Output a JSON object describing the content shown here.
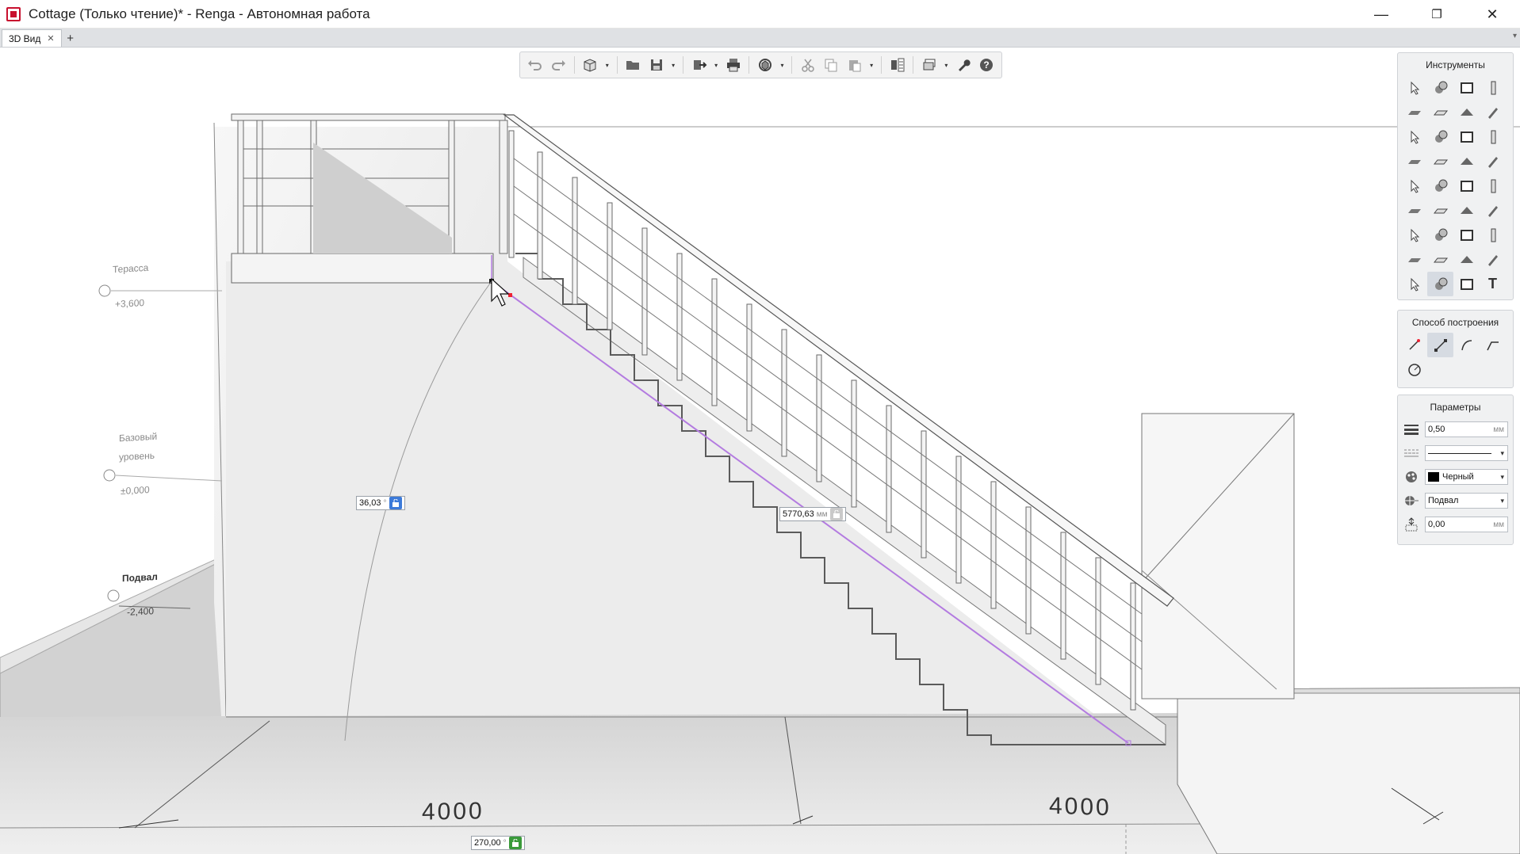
{
  "window": {
    "title": "Cottage (Только чтение)* - Renga - Автономная работа",
    "minimize": "—",
    "maximize": "❐",
    "close": "✕"
  },
  "tabs": [
    {
      "label": "3D Вид",
      "close": "✕"
    }
  ],
  "tab_add": "+",
  "tab_menu": "▾",
  "toolbar": {
    "icons": [
      "undo-icon",
      "redo-icon",
      "view-cube-icon",
      "open-folder-icon",
      "save-icon",
      "export-icon",
      "print-icon",
      "orbit-icon",
      "cut-icon",
      "copy-icon",
      "paste-icon",
      "compare-icon",
      "layers-icon",
      "wrench-icon",
      "help-icon"
    ],
    "dropdown_arrow": "▾"
  },
  "panels": {
    "tools": {
      "title": "Инструменты",
      "items": [
        "select",
        "assembly",
        "rectangle",
        "column",
        "beam",
        "slab",
        "roof",
        "brush",
        "stair-flight",
        "ramp",
        "door",
        "window",
        "railing",
        "line",
        "lamp",
        "pipe",
        "plumbing",
        "equipment",
        "ventilation",
        "fitting",
        "valve",
        "radiator",
        "duct-fan",
        "duct-fitting",
        "pump",
        "hood",
        "mech-fitting",
        "tank",
        "cabinet",
        "net",
        "device",
        "terminal",
        "dimension",
        "polyline",
        "hatch",
        "text"
      ],
      "selected_index": 33,
      "text_tool_glyph": "T"
    },
    "construction": {
      "title": "Способ построения",
      "items": [
        "by-point",
        "segment",
        "arc",
        "polyline-mode",
        "circle-mode"
      ],
      "selected_index": 1
    },
    "parameters": {
      "title": "Параметры",
      "thickness": {
        "value": "0,50",
        "unit": "мм"
      },
      "line_type": {
        "value": ""
      },
      "color": {
        "value": "Черный",
        "swatch": "#000000"
      },
      "level": {
        "value": "Подвал"
      },
      "offset": {
        "value": "0,00",
        "unit": "мм"
      },
      "dropdown_arrow": "▾"
    }
  },
  "viewport": {
    "levels": [
      {
        "name": "Терасса",
        "value": "+3,600"
      },
      {
        "name": "Базовый уровень",
        "name_line1": "Базовый",
        "name_line2": "уровень",
        "value": "±0,000"
      },
      {
        "name": "Подвал",
        "value": "-2,400"
      }
    ],
    "dimension_labels": [
      "4000",
      "4000"
    ],
    "angle_input": {
      "value": "36,03",
      "unit": "°"
    },
    "length_input": {
      "value": "5770,63",
      "unit": "мм"
    },
    "bottom_angle_input": {
      "value": "270,00",
      "unit": "°"
    },
    "colors": {
      "guide_line": "#b37be0",
      "accent_blue": "#3c7ad9",
      "lock_green": "#3a9a3a"
    }
  }
}
